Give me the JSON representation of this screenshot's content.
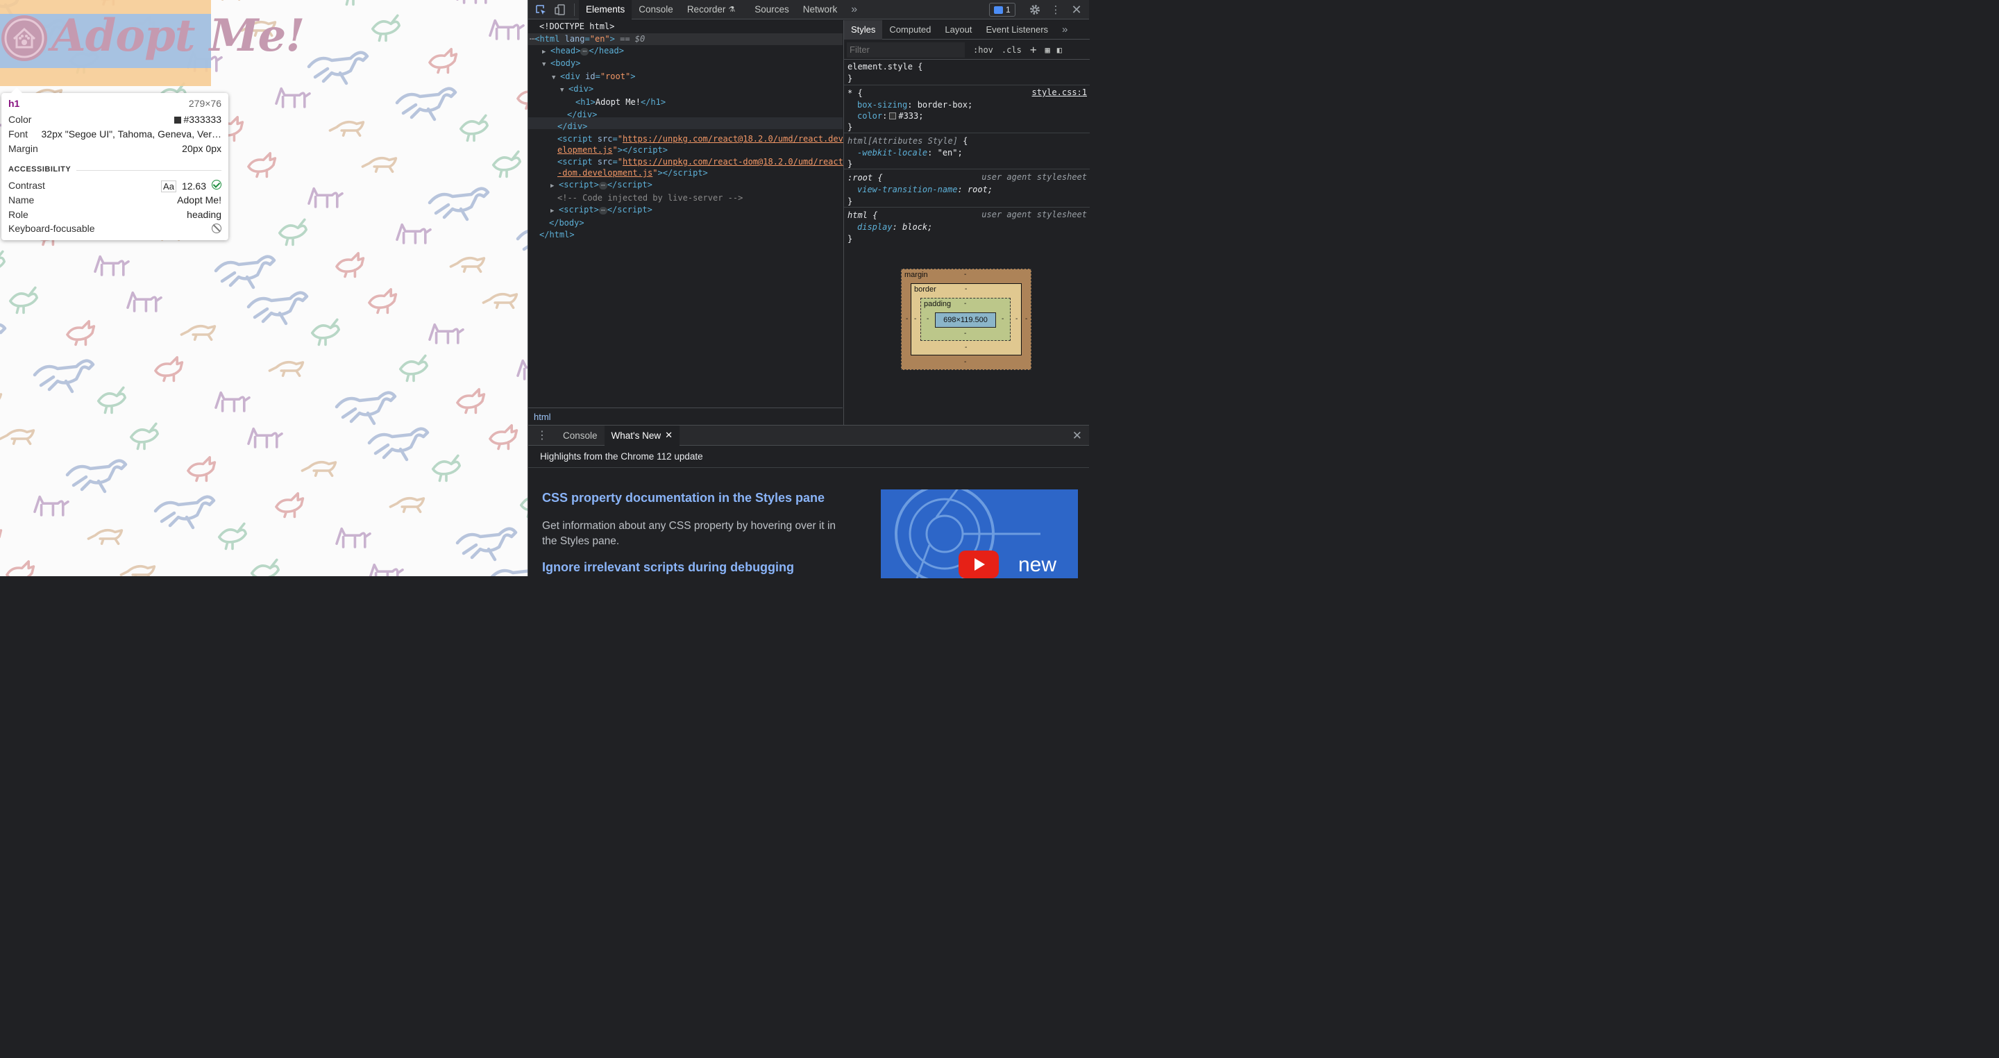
{
  "page": {
    "logo_text": "Adopt Me!",
    "tooltip": {
      "tag": "h1",
      "size": "279×76",
      "color_label": "Color",
      "color_value": "#333333",
      "font_label": "Font",
      "font_value": "32px \"Segoe UI\", Tahoma, Geneva, Ver…",
      "margin_label": "Margin",
      "margin_value": "20px 0px",
      "accessibility_heading": "ACCESSIBILITY",
      "contrast_label": "Contrast",
      "contrast_aa": "Aa",
      "contrast_value": "12.63",
      "name_label": "Name",
      "name_value": "Adopt Me!",
      "role_label": "Role",
      "role_value": "heading",
      "focusable_label": "Keyboard-focusable"
    }
  },
  "devtools": {
    "tabs": [
      "Elements",
      "Console",
      "Recorder",
      "Sources",
      "Network"
    ],
    "more_tabs": "»",
    "issues_count": "1",
    "elements": {
      "doctype": "<!DOCTYPE html>",
      "html_lang": "en",
      "html_suffix": "== $0",
      "h1_text": "Adopt Me!",
      "div_id": "root",
      "script1_src_a": "https://unpkg.com/react@18.2.0/umd/react.dev",
      "script1_src_b": "elopment.js",
      "script2_src_a": "https://unpkg.com/react-dom@18.2.0/umd/react",
      "script2_src_b": "-dom.development.js",
      "comment": "<!-- Code injected by live-server -->"
    },
    "breadcrumb": "html",
    "styles": {
      "tabs": [
        "Styles",
        "Computed",
        "Layout",
        "Event Listeners"
      ],
      "filter_placeholder": "Filter",
      "hov": ":hov",
      "cls": ".cls",
      "rules": {
        "element_style": "element.style {",
        "universal_selector": "* {",
        "universal_source": "style.css:1",
        "box_sizing_prop": "box-sizing",
        "box_sizing_val": "border-box;",
        "color_prop": "color",
        "color_val": "#333;",
        "attr_style_selector": "html[Attributes Style]",
        "webkit_locale_prop": "-webkit-locale",
        "webkit_locale_val": "\"en\";",
        "root_selector": ":root {",
        "ua_label": "user agent stylesheet",
        "vtn_prop": "view-transition-name",
        "vtn_val": "root;",
        "html_selector": "html {",
        "display_prop": "display",
        "display_val": "block;"
      },
      "box_model": {
        "margin_label": "margin",
        "border_label": "border",
        "padding_label": "padding",
        "content_size": "698×119.500",
        "dash": "-"
      }
    },
    "drawer": {
      "tabs": [
        "Console",
        "What's New"
      ],
      "heading": "Highlights from the Chrome 112 update",
      "item1_title": "CSS property documentation in the Styles pane",
      "item1_desc": "Get information about any CSS property by hovering over it in the Styles pane.",
      "item2_title": "Ignore irrelevant scripts during debugging",
      "video_label": "new"
    }
  }
}
